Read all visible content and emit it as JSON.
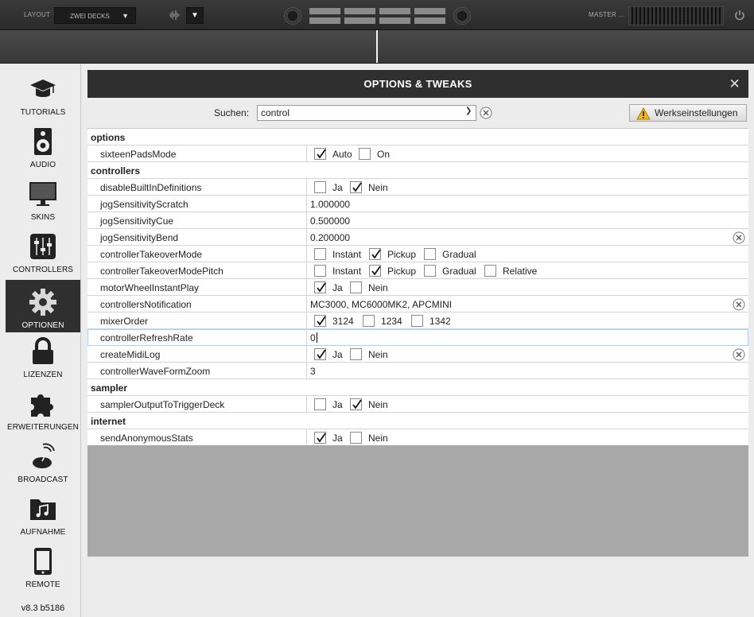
{
  "topbar": {
    "layout_label": "LAYOUT",
    "layout_value": "ZWEI DECKS",
    "master_label": "MASTER ..."
  },
  "sidebar": {
    "items": [
      {
        "label": "TUTORIALS",
        "icon": "graduation-cap-icon",
        "active": false
      },
      {
        "label": "AUDIO",
        "icon": "speaker-icon",
        "active": false
      },
      {
        "label": "SKINS",
        "icon": "monitor-icon",
        "active": false
      },
      {
        "label": "CONTROLLERS",
        "icon": "sliders-icon",
        "active": false
      },
      {
        "label": "OPTIONEN",
        "icon": "gear-icon",
        "active": true
      },
      {
        "label": "LIZENZEN",
        "icon": "lock-icon",
        "active": false
      },
      {
        "label": "ERWEITERUNGEN",
        "icon": "puzzle-icon",
        "active": false
      },
      {
        "label": "BROADCAST",
        "icon": "broadcast-icon",
        "active": false
      },
      {
        "label": "AUFNAHME",
        "icon": "music-folder-icon",
        "active": false
      },
      {
        "label": "REMOTE",
        "icon": "tablet-icon",
        "active": false
      }
    ],
    "version": "v8.3 b5186"
  },
  "dialog": {
    "title": "OPTIONS & TWEAKS",
    "close": "✕",
    "search_label": "Suchen:",
    "search_value": "control",
    "reset_label": "Werkseinstellungen"
  },
  "sections": {
    "options": "options",
    "controllers": "controllers",
    "sampler": "sampler",
    "internet": "internet"
  },
  "rows": {
    "sixteenPadsMode": {
      "name": "sixteenPadsMode",
      "o1": "Auto",
      "o2": "On"
    },
    "disableBuiltInDefinitions": {
      "name": "disableBuiltInDefinitions",
      "o1": "Ja",
      "o2": "Nein"
    },
    "jogSensitivityScratch": {
      "name": "jogSensitivityScratch",
      "value": "1.000000"
    },
    "jogSensitivityCue": {
      "name": "jogSensitivityCue",
      "value": "0.500000"
    },
    "jogSensitivityBend": {
      "name": "jogSensitivityBend",
      "value": "0.200000"
    },
    "controllerTakeoverMode": {
      "name": "controllerTakeoverMode",
      "o1": "Instant",
      "o2": "Pickup",
      "o3": "Gradual"
    },
    "controllerTakeoverModePitch": {
      "name": "controllerTakeoverModePitch",
      "o1": "Instant",
      "o2": "Pickup",
      "o3": "Gradual",
      "o4": "Relative"
    },
    "motorWheelInstantPlay": {
      "name": "motorWheelInstantPlay",
      "o1": "Ja",
      "o2": "Nein"
    },
    "controllersNotification": {
      "name": "controllersNotification",
      "value": "MC3000, MC6000MK2, APCMINI"
    },
    "mixerOrder": {
      "name": "mixerOrder",
      "o1": "3124",
      "o2": "1234",
      "o3": "1342"
    },
    "controllerRefreshRate": {
      "name": "controllerRefreshRate",
      "value": "0"
    },
    "createMidiLog": {
      "name": "createMidiLog",
      "o1": "Ja",
      "o2": "Nein"
    },
    "controllerWaveFormZoom": {
      "name": "controllerWaveFormZoom",
      "value": "3"
    },
    "samplerOutputToTriggerDeck": {
      "name": "samplerOutputToTriggerDeck",
      "o1": "Ja",
      "o2": "Nein"
    },
    "sendAnonymousStats": {
      "name": "sendAnonymousStats",
      "o1": "Ja",
      "o2": "Nein"
    }
  },
  "colors": {
    "active_sidebar": "#2f2f2f",
    "title_bar": "#2f2f2f",
    "empty_area": "#a8a8a8"
  }
}
